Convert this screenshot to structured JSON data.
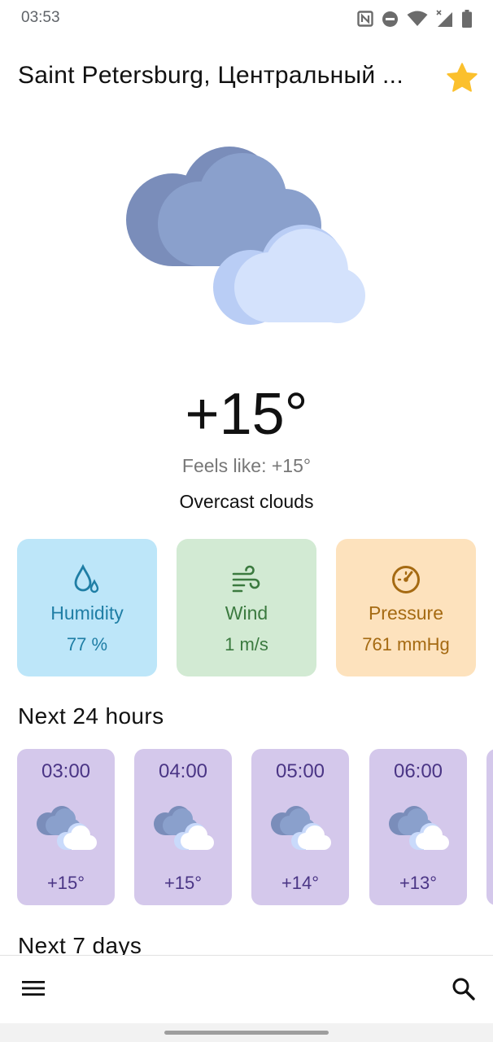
{
  "status_bar": {
    "time": "03:53",
    "icons": [
      "nfc-icon",
      "do-not-disturb-icon",
      "wifi-icon",
      "cell-signal-icon",
      "battery-icon"
    ]
  },
  "header": {
    "location": "Saint Petersburg, Центральный ...",
    "favorite_icon": "star-icon",
    "favorite_color": "#fbc02d"
  },
  "current": {
    "icon": "overcast-clouds-icon",
    "temperature": "+15°",
    "feels_like": "Feels like: +15°",
    "description": "Overcast clouds"
  },
  "metrics": [
    {
      "icon": "humidity-icon",
      "label": "Humidity",
      "value": "77 %",
      "bg": "#bde6f9",
      "fg": "#1f7ea5"
    },
    {
      "icon": "wind-icon",
      "label": "Wind",
      "value": "1 m/s",
      "bg": "#d2ead3",
      "fg": "#3b7a3f"
    },
    {
      "icon": "pressure-gauge-icon",
      "label": "Pressure",
      "value": "761 mmHg",
      "bg": "#fde2bd",
      "fg": "#a56a12"
    }
  ],
  "hourly_section": {
    "title": "Next 24 hours",
    "items": [
      {
        "time": "03:00",
        "icon": "clouds-icon",
        "temp": "+15°"
      },
      {
        "time": "04:00",
        "icon": "clouds-icon",
        "temp": "+15°"
      },
      {
        "time": "05:00",
        "icon": "clouds-icon",
        "temp": "+14°"
      },
      {
        "time": "06:00",
        "icon": "clouds-icon",
        "temp": "+13°"
      }
    ]
  },
  "daily_section": {
    "title": "Next 7 days"
  },
  "bottom_bar": {
    "menu_icon": "menu-icon",
    "search_icon": "search-icon"
  },
  "colors": {
    "hour_card_bg": "#d4c8eb",
    "hour_card_fg": "#4a3585"
  }
}
